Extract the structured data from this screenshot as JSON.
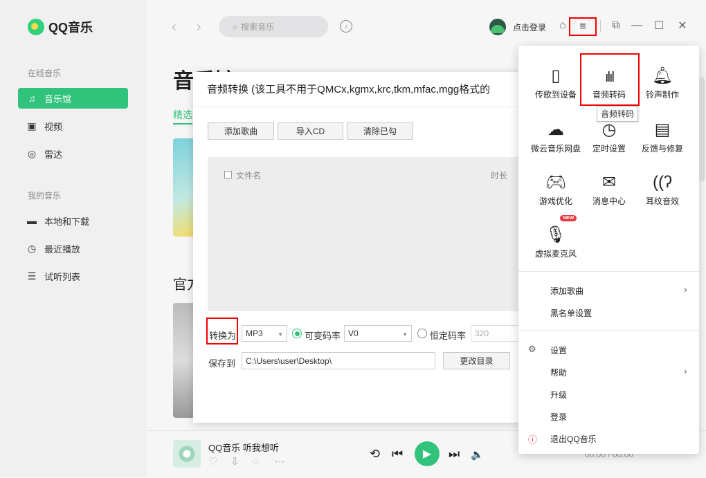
{
  "app": {
    "logo_text": "QQ音乐",
    "search_placeholder": "搜索音乐",
    "login_text": "点击登录"
  },
  "sidebar": {
    "online_label": "在线音乐",
    "online_items": [
      {
        "label": "音乐馆",
        "icon": "music-note-icon"
      },
      {
        "label": "视频",
        "icon": "video-icon"
      },
      {
        "label": "雷达",
        "icon": "radar-icon"
      }
    ],
    "my_label": "我的音乐",
    "my_items": [
      {
        "label": "本地和下载",
        "icon": "monitor-icon"
      },
      {
        "label": "最近播放",
        "icon": "clock-icon"
      },
      {
        "label": "试听列表",
        "icon": "playlist-icon"
      }
    ]
  },
  "main": {
    "title": "音乐馆",
    "tab_selected": "精选",
    "section2": "官方"
  },
  "player": {
    "song": "QQ音乐 听我想听",
    "time": "00:00 / 00:00"
  },
  "dialog": {
    "title": "音频转换 (该工具不用于QMCx,kgmx,krc,tkm,mfac,mgg格式的",
    "buttons": [
      "添加歌曲",
      "导入CD",
      "清除已勾"
    ],
    "col_filename": "文件名",
    "col_duration": "时长",
    "convert_to_label": "转换为",
    "format_value": "MP3",
    "vbr_label": "可变码率",
    "vbr_value": "V0",
    "cbr_label": "恒定码率",
    "cbr_value": "320",
    "save_to_label": "保存到",
    "save_path": "C:\\Users\\user\\Desktop\\",
    "change_dir_button": "更改目录"
  },
  "menu": {
    "tiles": [
      {
        "label": "传歌到设备",
        "icon": "phone-icon"
      },
      {
        "label": "音频转码",
        "icon": "waveform-icon"
      },
      {
        "label": "铃声制作",
        "icon": "bell-icon"
      },
      {
        "label": "微云音乐网盘",
        "icon": "cloud-icon"
      },
      {
        "label": "定时设置",
        "icon": "timer-icon"
      },
      {
        "label": "反馈与修复",
        "icon": "feedback-icon"
      },
      {
        "label": "游戏优化",
        "icon": "gamepad-icon"
      },
      {
        "label": "消息中心",
        "icon": "envelope-icon"
      },
      {
        "label": "耳纹音效",
        "icon": "ear-icon"
      },
      {
        "label": "虚拟麦克风",
        "icon": "microphone-icon"
      }
    ],
    "new_badge": "NEW",
    "tooltip": "音频转码",
    "items": [
      {
        "label": "添加歌曲",
        "has_submenu": true
      },
      {
        "label": "黑名单设置",
        "has_submenu": false
      },
      {
        "label": "设置",
        "has_submenu": false
      },
      {
        "label": "帮助",
        "has_submenu": true
      },
      {
        "label": "升级",
        "has_submenu": false
      },
      {
        "label": "登录",
        "has_submenu": false
      },
      {
        "label": "退出QQ音乐",
        "has_submenu": false
      }
    ]
  },
  "colors": {
    "accent": "#31c27c",
    "highlight_box": "#e00000"
  }
}
